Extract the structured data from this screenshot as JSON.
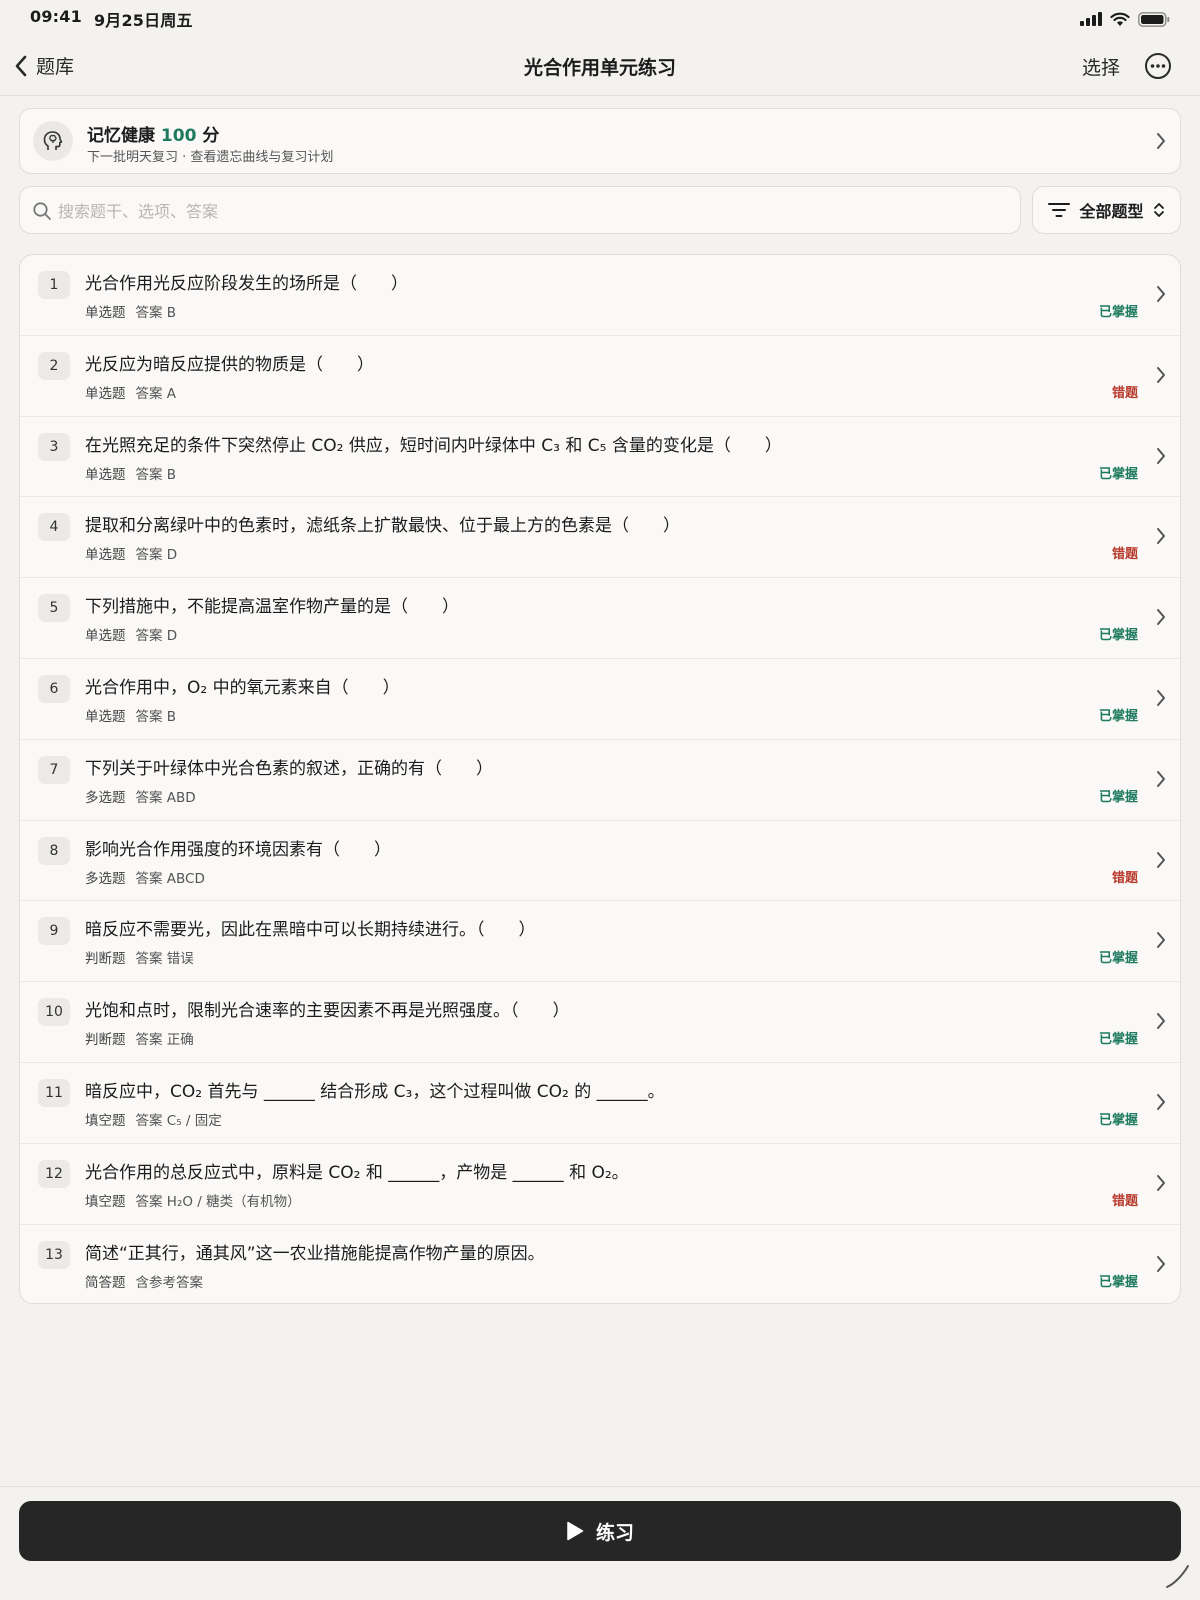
{
  "status_bar": {
    "time": "09:41",
    "date": "9月25日周五"
  },
  "nav": {
    "back_label": "题库",
    "title": "光合作用单元练习",
    "select_label": "选择"
  },
  "health": {
    "title_prefix": "记忆健康",
    "score": "100",
    "title_suffix": "分",
    "subtitle": "下一批明天复习 · 查看遗忘曲线与复习计划"
  },
  "search": {
    "placeholder": "搜索题干、选项、答案"
  },
  "filter": {
    "label": "全部题型"
  },
  "questions": [
    {
      "num": "1",
      "text": "光合作用光反应阶段发生的场所是（　　）",
      "type": "单选题",
      "answer": "答案 B",
      "status": "已掌握",
      "status_kind": "ok"
    },
    {
      "num": "2",
      "text": "光反应为暗反应提供的物质是（　　）",
      "type": "单选题",
      "answer": "答案 A",
      "status": "错题",
      "status_kind": "err"
    },
    {
      "num": "3",
      "text": "在光照充足的条件下突然停止 CO₂ 供应，短时间内叶绿体中 C₃ 和 C₅ 含量的变化是（　　）",
      "type": "单选题",
      "answer": "答案 B",
      "status": "已掌握",
      "status_kind": "ok"
    },
    {
      "num": "4",
      "text": "提取和分离绿叶中的色素时，滤纸条上扩散最快、位于最上方的色素是（　　）",
      "type": "单选题",
      "answer": "答案 D",
      "status": "错题",
      "status_kind": "err"
    },
    {
      "num": "5",
      "text": "下列措施中，不能提高温室作物产量的是（　　）",
      "type": "单选题",
      "answer": "答案 D",
      "status": "已掌握",
      "status_kind": "ok"
    },
    {
      "num": "6",
      "text": "光合作用中，O₂ 中的氧元素来自（　　）",
      "type": "单选题",
      "answer": "答案 B",
      "status": "已掌握",
      "status_kind": "ok"
    },
    {
      "num": "7",
      "text": "下列关于叶绿体中光合色素的叙述，正确的有（　　）",
      "type": "多选题",
      "answer": "答案 ABD",
      "status": "已掌握",
      "status_kind": "ok"
    },
    {
      "num": "8",
      "text": "影响光合作用强度的环境因素有（　　）",
      "type": "多选题",
      "answer": "答案 ABCD",
      "status": "错题",
      "status_kind": "err"
    },
    {
      "num": "9",
      "text": "暗反应不需要光，因此在黑暗中可以长期持续进行。（　　）",
      "type": "判断题",
      "answer": "答案 错误",
      "status": "已掌握",
      "status_kind": "ok"
    },
    {
      "num": "10",
      "text": "光饱和点时，限制光合速率的主要因素不再是光照强度。（　　）",
      "type": "判断题",
      "answer": "答案 正确",
      "status": "已掌握",
      "status_kind": "ok"
    },
    {
      "num": "11",
      "text": "暗反应中，CO₂ 首先与 ______ 结合形成 C₃，这个过程叫做 CO₂ 的 ______。",
      "type": "填空题",
      "answer": "答案 C₅ / 固定",
      "status": "已掌握",
      "status_kind": "ok"
    },
    {
      "num": "12",
      "text": "光合作用的总反应式中，原料是 CO₂ 和 ______，产物是 ______ 和 O₂。",
      "type": "填空题",
      "answer": "答案 H₂O / 糖类（有机物）",
      "status": "错题",
      "status_kind": "err"
    },
    {
      "num": "13",
      "text": "简述“正其行，通其风”这一农业措施能提高作物产量的原因。",
      "type": "简答题",
      "answer": "含参考答案",
      "status": "已掌握",
      "status_kind": "ok"
    }
  ],
  "practice": {
    "label": "练习"
  },
  "colors": {
    "mastered": "#1d7a5e",
    "wrong": "#b83a2c",
    "button_bg": "#262626"
  }
}
